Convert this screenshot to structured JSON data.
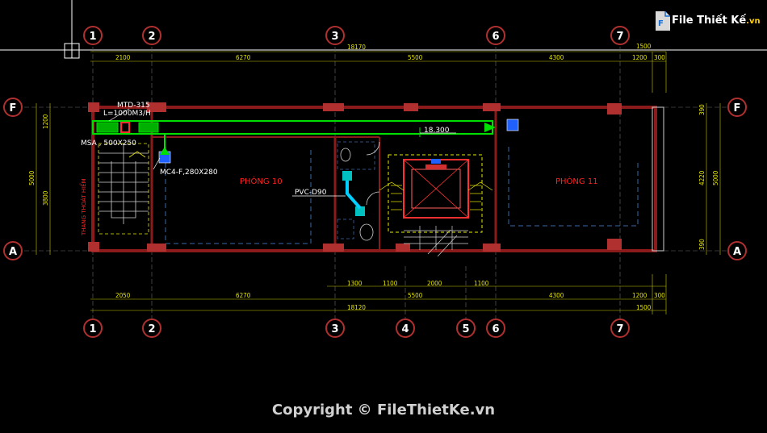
{
  "grid": {
    "top_bubbles": [
      "1",
      "2",
      "3",
      "6",
      "7"
    ],
    "bottom_bubbles": [
      "1",
      "2",
      "3",
      "4",
      "5",
      "6",
      "7"
    ],
    "row_bubbles": [
      "F",
      "A"
    ]
  },
  "dims": {
    "top_overall": "18170",
    "top_segments": [
      "2100",
      "6270",
      "5500",
      "4300",
      "1200",
      "300"
    ],
    "top_right": "1500",
    "bottom_segments_1": [
      "1300",
      "1100",
      "2000",
      "1100"
    ],
    "bottom_segments_2": [
      "2050",
      "6270",
      "5500",
      "4300",
      "1200",
      "300"
    ],
    "bottom_overall": "18120",
    "bottom_right": "1500",
    "left_outer": "5000",
    "left_top": "1200",
    "left_inner": "3800",
    "right_outer": "5000",
    "right_inner": "4220",
    "right_top": "390",
    "right_bottom": "390"
  },
  "notes": {
    "mtd": "MTD-315",
    "flow": "L=1000M3/H",
    "msa": "MSA , 500X250",
    "mc": "MC4-F,280X280",
    "pvc": "PVC-D90",
    "level": "18.300",
    "stair": "THANG THOÁT HIỂM"
  },
  "rooms": {
    "room_10": "PHÒNG 10",
    "room_11": "PHÒNG 11"
  },
  "logo": {
    "main": "File Thiết Kế",
    "suffix": ".vn"
  },
  "copyright": "Copyright © FileThietKe.vn",
  "colors": {
    "background": "#000000",
    "wall": "#8b1a1a",
    "column": "#b03030",
    "duct": "#00e000",
    "dimension": "#e8e800",
    "bubble": "#ffffff",
    "room_label": "#ff2020",
    "stair": "#e8e800",
    "accent_blue": "#2060ff"
  }
}
